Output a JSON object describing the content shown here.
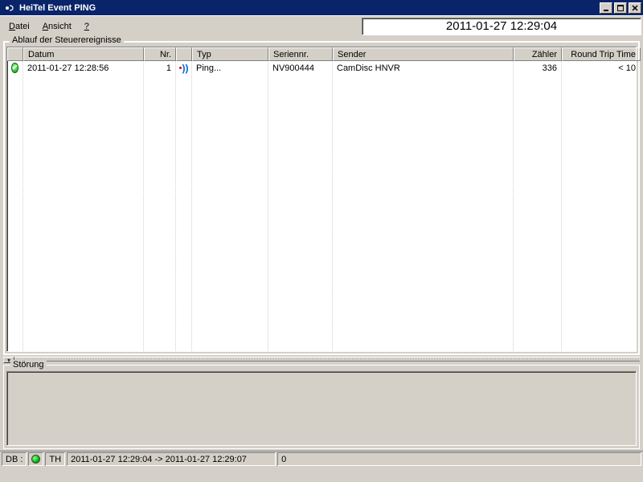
{
  "window": {
    "title": "HeiTel Event PING"
  },
  "menu": {
    "datei": "Datei",
    "ansicht": "Ansicht",
    "help": "?"
  },
  "clock": "2011-01-27 12:29:04",
  "group_events": {
    "label": "Ablauf der Steuerereignisse"
  },
  "columns": {
    "datum": "Datum",
    "nr": "Nr.",
    "typ": "Typ",
    "seriennr": "Seriennr.",
    "sender": "Sender",
    "zahler": "Zähler",
    "rtt": "Round Trip Time"
  },
  "rows": [
    {
      "datum": "2011-01-27 12:28:56",
      "nr": "1",
      "typ": "Ping...",
      "seriennr": "NV900444",
      "sender": "CamDisc HNVR",
      "zahler": "336",
      "rtt": "< 10"
    }
  ],
  "group_fault": {
    "label": "Störung"
  },
  "status": {
    "db": "DB :",
    "th": "TH",
    "range": "2011-01-27 12:29:04  ->  2011-01-27 12:29:07",
    "extra": "0"
  }
}
